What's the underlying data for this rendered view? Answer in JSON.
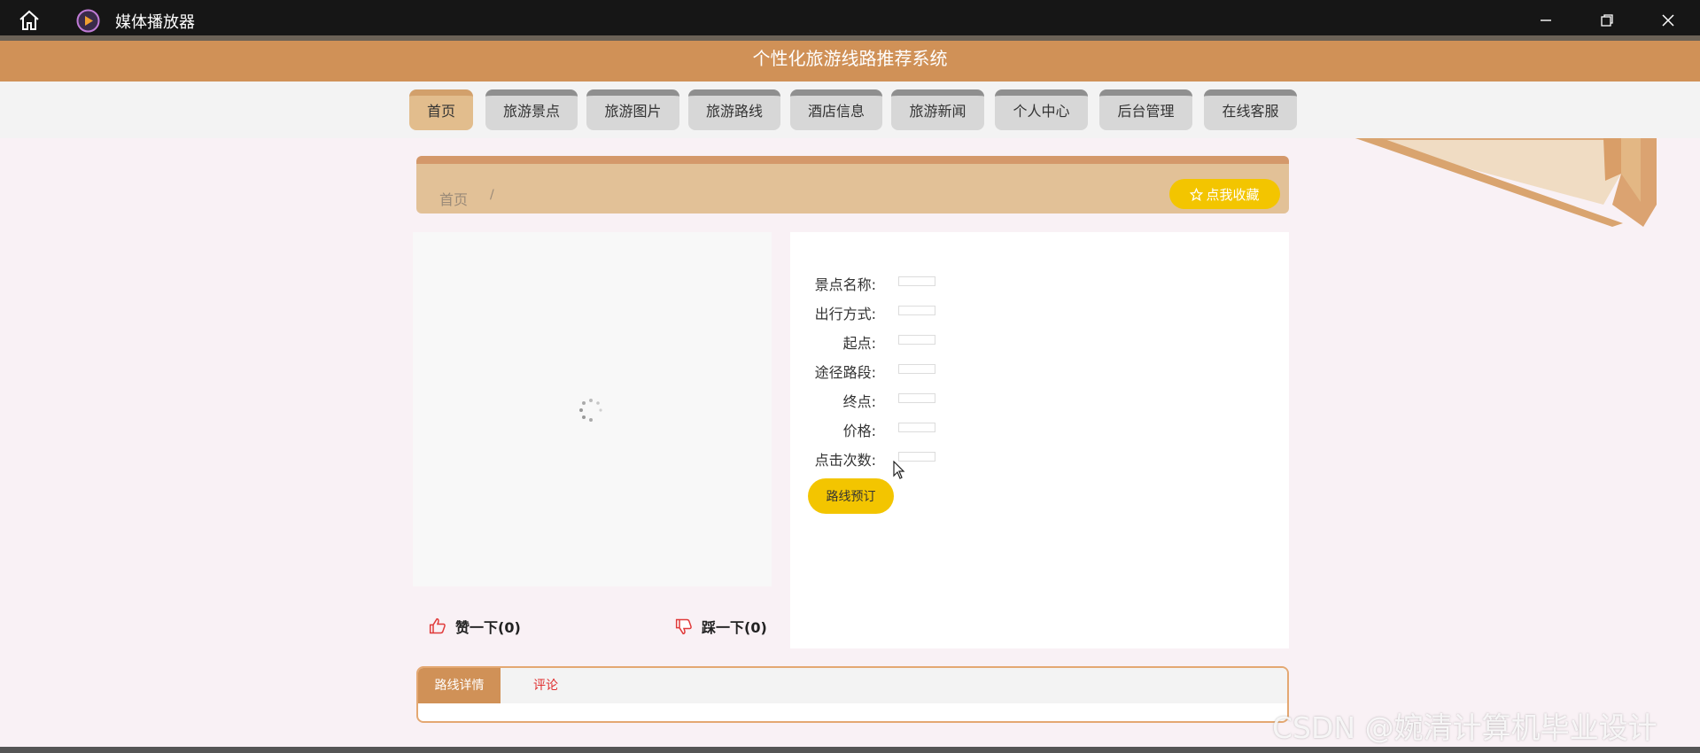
{
  "window": {
    "title": "媒体播放器",
    "icons": {
      "home": "home-icon",
      "app": "media-player-icon",
      "min": "minimize-icon",
      "max": "restore-icon",
      "close": "close-icon"
    }
  },
  "header": {
    "title": "个性化旅游线路推荐系统"
  },
  "nav": {
    "items": [
      {
        "label": "首页",
        "active": true
      },
      {
        "label": "旅游景点"
      },
      {
        "label": "旅游图片"
      },
      {
        "label": "旅游路线"
      },
      {
        "label": "酒店信息"
      },
      {
        "label": "旅游新闻"
      },
      {
        "label": "个人中心"
      },
      {
        "label": "后台管理"
      },
      {
        "label": "在线客服"
      }
    ]
  },
  "breadcrumb": {
    "home": "首页",
    "sep": "/"
  },
  "favorite": {
    "label": "点我收藏",
    "icon": "star-outline-icon"
  },
  "reactions": {
    "like_label": "赞一下(0)",
    "dislike_label": "踩一下(0)"
  },
  "details": {
    "fields": [
      {
        "label": "景点名称:",
        "value": ""
      },
      {
        "label": "出行方式:",
        "value": ""
      },
      {
        "label": "起点:",
        "value": ""
      },
      {
        "label": "途径路段:",
        "value": ""
      },
      {
        "label": "终点:",
        "value": ""
      },
      {
        "label": "价格:",
        "value": ""
      },
      {
        "label": "点击次数:",
        "value": ""
      }
    ],
    "book_label": "路线预订"
  },
  "tabs": {
    "items": [
      {
        "label": "路线详情",
        "active": true
      },
      {
        "label": "评论"
      }
    ]
  },
  "watermark": {
    "text": "CSDN @婉清计算机毕业设计"
  },
  "colors": {
    "accent": "#d09157",
    "button_yellow": "#f3c500",
    "tab_red": "#e02f2f"
  }
}
